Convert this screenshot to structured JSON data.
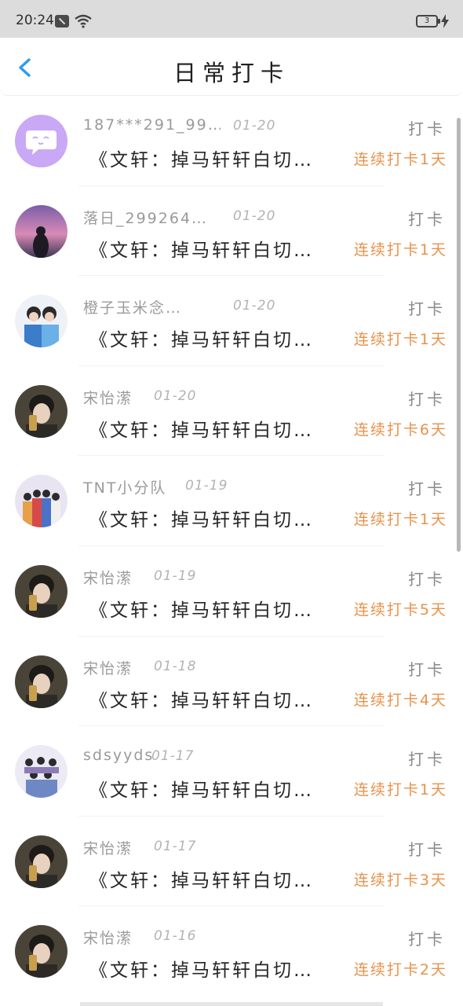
{
  "status_bar": {
    "time": "20:24",
    "battery_level": "3"
  },
  "header": {
    "title": "日常打卡"
  },
  "colors": {
    "accent_back": "#2b9bf0",
    "streak": "#e8924b",
    "muted": "#9a9a9a"
  },
  "items": [
    {
      "username": "187***291_99…",
      "date": "01-20",
      "tag": "打卡",
      "content": "《文轩：掉马轩轩白切…",
      "streak": "连续打卡1天",
      "avatar": "purple-chat-icon"
    },
    {
      "username": "落日_299264…",
      "date": "01-20",
      "tag": "打卡",
      "content": "《文轩：掉马轩轩白切…",
      "streak": "连续打卡1天",
      "avatar": "sunset-photo"
    },
    {
      "username": "橙子玉米念…",
      "date": "01-20",
      "tag": "打卡",
      "content": "《文轩：掉马轩轩白切…",
      "streak": "连续打卡1天",
      "avatar": "two-people-photo"
    },
    {
      "username": "宋怡潆",
      "date": "01-20",
      "tag": "打卡",
      "content": "《文轩：掉马轩轩白切…",
      "streak": "连续打卡6天",
      "avatar": "selfie-photo"
    },
    {
      "username": "TNT小分队",
      "date": "01-19",
      "tag": "打卡",
      "content": "《文轩：掉马轩轩白切…",
      "streak": "连续打卡1天",
      "avatar": "group-photo"
    },
    {
      "username": "宋怡潆",
      "date": "01-19",
      "tag": "打卡",
      "content": "《文轩：掉马轩轩白切…",
      "streak": "连续打卡5天",
      "avatar": "selfie-photo"
    },
    {
      "username": "宋怡潆",
      "date": "01-18",
      "tag": "打卡",
      "content": "《文轩：掉马轩轩白切…",
      "streak": "连续打卡4天",
      "avatar": "selfie-photo"
    },
    {
      "username": "sdsyyds",
      "date": "01-17",
      "tag": "打卡",
      "content": "《文轩：掉马轩轩白切…",
      "streak": "连续打卡1天",
      "avatar": "group-photo-2"
    },
    {
      "username": "宋怡潆",
      "date": "01-17",
      "tag": "打卡",
      "content": "《文轩：掉马轩轩白切…",
      "streak": "连续打卡3天",
      "avatar": "selfie-photo"
    },
    {
      "username": "宋怡潆",
      "date": "01-16",
      "tag": "打卡",
      "content": "《文轩：掉马轩轩白切…",
      "streak": "连续打卡2天",
      "avatar": "selfie-photo"
    }
  ]
}
